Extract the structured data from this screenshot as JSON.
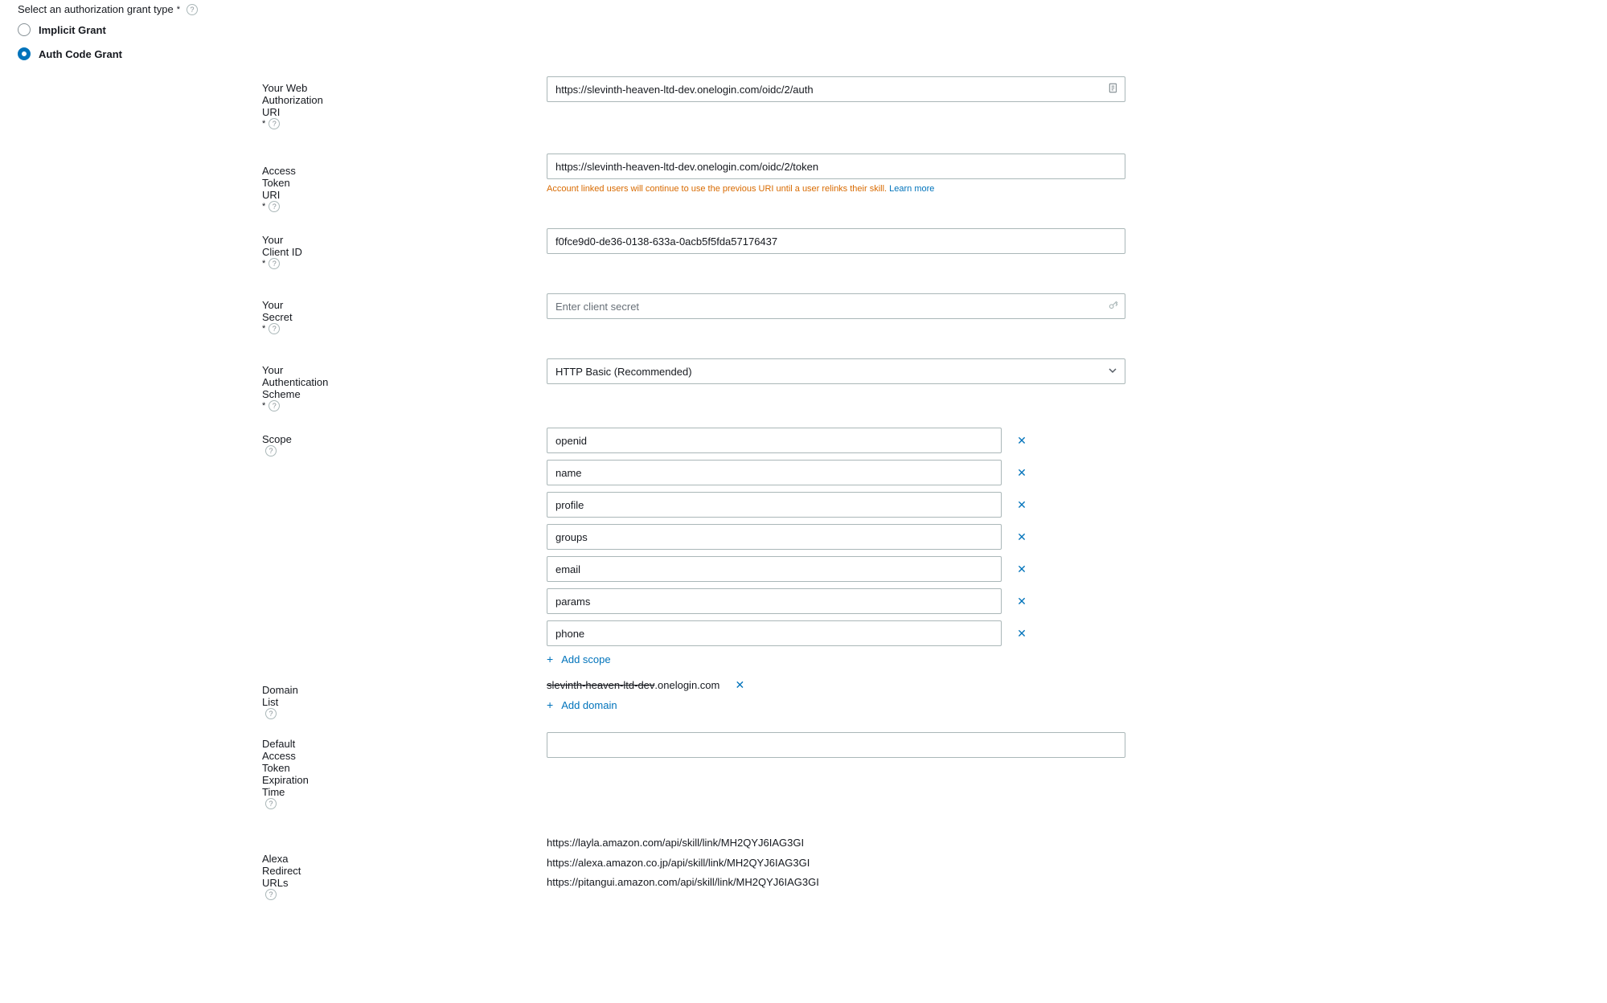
{
  "grant": {
    "heading": "Select an authorization grant type",
    "options": {
      "implicit": "Implicit Grant",
      "authcode": "Auth Code Grant"
    }
  },
  "fields": {
    "web_auth_uri": {
      "label": "Your Web Authorization URI",
      "value": "https://slevinth-heaven-ltd-dev.onelogin.com/oidc/2/auth"
    },
    "access_token_uri": {
      "label": "Access Token URI",
      "value": "https://slevinth-heaven-ltd-dev.onelogin.com/oidc/2/token",
      "helper": "Account linked users will continue to use the previous URI until a user relinks their skill.",
      "learn_more": "Learn more"
    },
    "client_id": {
      "label": "Your Client ID",
      "value": "f0fce9d0-de36-0138-633a-0acb5f5fda57176437"
    },
    "secret": {
      "label": "Your Secret",
      "placeholder": "Enter client secret"
    },
    "auth_scheme": {
      "label": "Your Authentication Scheme",
      "value": "HTTP Basic (Recommended)"
    },
    "scope": {
      "label": "Scope",
      "items": [
        "openid",
        "name",
        "profile",
        "groups",
        "email",
        "params",
        "phone"
      ],
      "add": "Add scope"
    },
    "domain_list": {
      "label": "Domain List",
      "items": [
        {
          "strike": "slevinth-heaven-ltd-dev",
          "rest": ".onelogin.com"
        }
      ],
      "add": "Add domain"
    },
    "default_expiration": {
      "label": "Default Access Token Expiration Time",
      "value": ""
    },
    "redirect_urls": {
      "label": "Alexa Redirect URLs",
      "items": [
        "https://layla.amazon.com/api/skill/link/MH2QYJ6IAG3GI",
        "https://alexa.amazon.co.jp/api/skill/link/MH2QYJ6IAG3GI",
        "https://pitangui.amazon.com/api/skill/link/MH2QYJ6IAG3GI"
      ]
    }
  }
}
